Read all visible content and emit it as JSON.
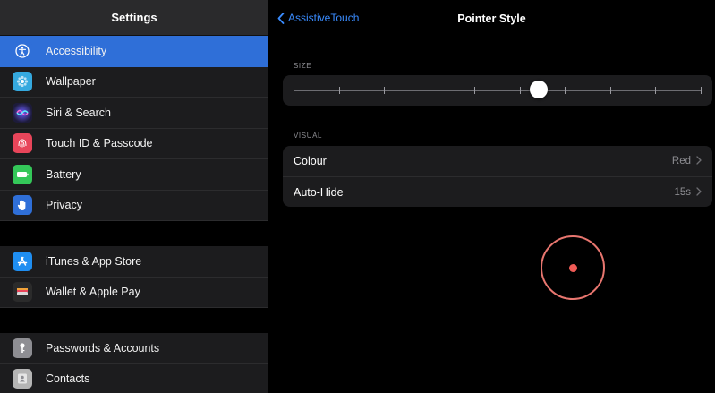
{
  "sidebar": {
    "title": "Settings",
    "groups": [
      {
        "items": [
          {
            "label": "Accessibility",
            "icon": "accessibility-icon",
            "color": "#2f6fd8",
            "selected": true
          },
          {
            "label": "Wallpaper",
            "icon": "wallpaper-icon",
            "color": "#35a9df"
          },
          {
            "label": "Siri & Search",
            "icon": "siri-icon",
            "color": "#3a3a8c"
          },
          {
            "label": "Touch ID & Passcode",
            "icon": "fingerprint-icon",
            "color": "#e8455a"
          },
          {
            "label": "Battery",
            "icon": "battery-icon",
            "color": "#34c759"
          },
          {
            "label": "Privacy",
            "icon": "hand-icon",
            "color": "#2f6fd8"
          }
        ]
      },
      {
        "items": [
          {
            "label": "iTunes & App Store",
            "icon": "app-store-icon",
            "color": "#1f8ef1"
          },
          {
            "label": "Wallet & Apple Pay",
            "icon": "wallet-icon",
            "color": "#2b2b2b"
          }
        ]
      },
      {
        "items": [
          {
            "label": "Passwords & Accounts",
            "icon": "key-icon",
            "color": "#8e8e93"
          },
          {
            "label": "Contacts",
            "icon": "contacts-icon",
            "color": "#b5b5b5"
          }
        ]
      }
    ]
  },
  "navbar": {
    "back_label": "AssistiveTouch",
    "title": "Pointer Style"
  },
  "size_section": {
    "label": "SIZE",
    "tick_count": 10,
    "value_fraction": 0.6
  },
  "visual_section": {
    "label": "VISUAL",
    "rows": [
      {
        "label": "Colour",
        "value": "Red"
      },
      {
        "label": "Auto-Hide",
        "value": "15s"
      }
    ]
  },
  "pointer_preview": {
    "ring_color": "#e8766f",
    "dot_color": "#ef5b56"
  }
}
